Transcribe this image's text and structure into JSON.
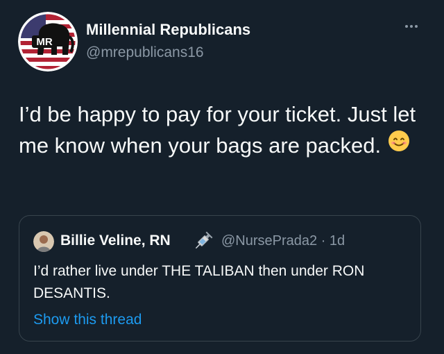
{
  "author": {
    "display_name": "Millennial Republicans",
    "handle": "@mrepublicans16",
    "avatar_text": "MR"
  },
  "tweet": {
    "text": "I’d be happy to pay for your ticket. Just let me know when your bags are packed.",
    "emoji": "smiling-face-icon"
  },
  "quoted": {
    "display_name": "Billie Veline, RN",
    "badge_icon": "syringe-icon",
    "handle_time": "@NursePrada2 · 1d",
    "text": "I’d rather live under THE TALIBAN then under RON DESANTIS.",
    "show_thread": "Show this thread"
  },
  "colors": {
    "background": "#15202b",
    "text": "#f7f9f9",
    "secondary": "#8b98a5",
    "link": "#1d9bf0",
    "border": "#38444d"
  }
}
